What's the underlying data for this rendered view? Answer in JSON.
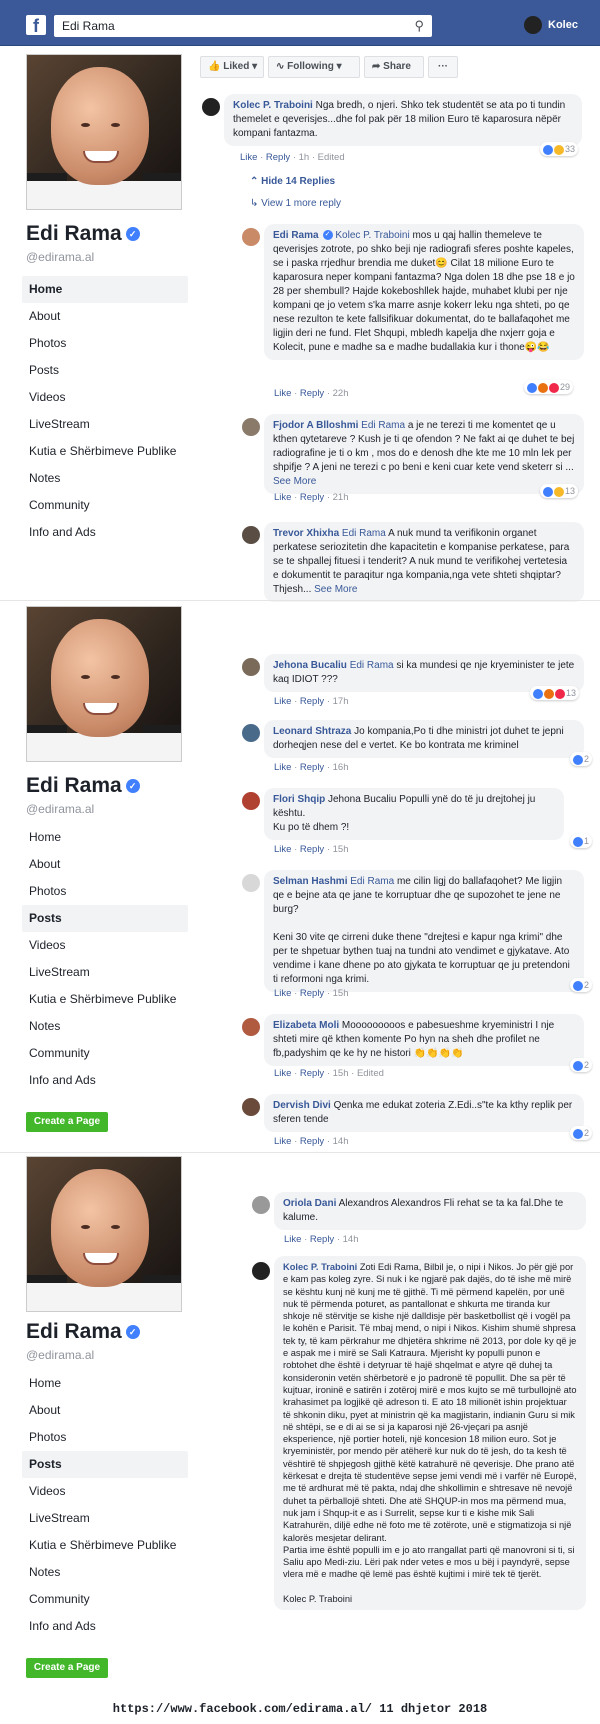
{
  "topbar": {
    "search_value": "Edi Rama",
    "user_name": "Kolec"
  },
  "profile": {
    "name": "Edi Rama",
    "handle": "@edirama.al",
    "nav": [
      "Home",
      "About",
      "Photos",
      "Posts",
      "Videos",
      "LiveStream",
      "Kutia e Shërbimeve Publike",
      "Notes",
      "Community",
      "Info and Ads"
    ],
    "create_page": "Create a Page"
  },
  "actions": {
    "liked": "Liked",
    "following": "Following",
    "share": "Share",
    "more": "···"
  },
  "c1": {
    "author": "Kolec P. Traboini",
    "text": "Nga bredh, o njeri. Shko tek studentët se ata po ti tundin themelet e qeverisjes...dhe fol pak për 18 milion Euro të kaparosura nëpër kompani fantazma.",
    "like": "Like",
    "reply": "Reply",
    "time": "1h",
    "edited": "Edited",
    "reacts": "33"
  },
  "hide_replies": "Hide 14 Replies",
  "more_reply": "View 1 more reply",
  "r1": {
    "author": "Edi Rama",
    "mention": "Kolec P. Traboini",
    "text": "mos u qaj hallin themeleve te qeverisjes zotrote, po shko beji nje radiografi sferes poshte kapeles, se i paska rrjedhur brendia me duket😊 Cilat 18 milione Euro te kaparosura neper kompani fantazma? Nga dolen 18 dhe pse 18 e jo 28 per shembull? Hajde kokeboshllek hajde, muhabet klubi per nje kompani qe jo vetem s'ka marre asnje kokerr leku nga shteti, po qe nese rezulton te kete fallsifikuar dokumentat, do te ballafaqohet me ligjin deri ne fund. Flet Shqupi, mbledh kapelja dhe nxjerr goja e Kolecit, pune e madhe sa e madhe budallakia kur i thone😜😂",
    "like": "Like",
    "reply": "Reply",
    "time": "22h",
    "reacts": "29"
  },
  "r2": {
    "author": "Fjodor A Blloshmi",
    "mention": "Edi Rama",
    "text": "a je ne terezi ti me komentet qe u kthen qytetareve ? Kush je ti qe ofendon ? Ne fakt ai qe duhet te bej radiografine je ti o km , mos do e denosh dhe kte me 10 mln lek per shpifje ? A jeni ne terezi c po beni e keni cuar kete vend sketerr si ...",
    "see_more": "See More",
    "like": "Like",
    "reply": "Reply",
    "time": "21h",
    "reacts": "13"
  },
  "r3": {
    "author": "Trevor Xhixha",
    "mention": "Edi Rama",
    "text": "A nuk mund ta verifikonin organet perkatese seriozitetin dhe kapacitetin e kompanise perkatese, para se te shpallej fituesi i tenderit? A nuk mund te verifikohej vertetesia e dokumentit te paraqitur nga kompania,nga vete shteti shqiptar?Thjesh...",
    "see_more": "See More"
  },
  "r4": {
    "author": "Jehona Bucaliu",
    "mention": "Edi Rama",
    "text": "si ka mundesi qe nje kryeminister te jete kaq IDIOT ???",
    "like": "Like",
    "reply": "Reply",
    "time": "17h",
    "reacts": "13"
  },
  "r5": {
    "author": "Leonard Shtraza",
    "text": "Jo kompania,Po ti dhe ministri jot duhet te jepni dorheqjen nese del e vertet. Ke bo kontrata me kriminel",
    "like": "Like",
    "reply": "Reply",
    "time": "16h",
    "reacts": "2"
  },
  "r6": {
    "author": "Flori Shqip",
    "text": "Jehona Bucaliu Populli ynë do të ju drejtohej ju kështu.",
    "text2": "Ku po të dhem ?!",
    "like": "Like",
    "reply": "Reply",
    "time": "15h",
    "reacts": "1"
  },
  "r7": {
    "author": "Selman Hashmi",
    "mention": "Edi Rama",
    "text": "me cilin ligj do ballafaqohet? Me ligjin qe e bejne ata qe jane te korruptuar dhe qe supozohet te jene ne burg?",
    "text2": "Keni 30 vite qe cirreni duke thene \"drejtesi e kapur nga krimi\" dhe per te shpetuar bythen tuaj na tundni ato vendimet e gjykatave. Ato vendime i kane dhene po ato gjykata te korruptuar qe ju pretendoni ti reformoni nga krimi.",
    "like": "Like",
    "reply": "Reply",
    "time": "15h",
    "reacts": "2"
  },
  "r8": {
    "author": "Elizabeta Moli",
    "text": "Mooooooooos e pabesueshme kryeministri I nje shteti mire që kthen komente Po hyn na sheh dhe profilet ne fb,padyshim qe ke hy ne histori 👏👏👏👏",
    "like": "Like",
    "reply": "Reply",
    "time": "15h",
    "edited": "Edited",
    "reacts": "2"
  },
  "r9": {
    "author": "Dervish Divi",
    "text": "Qenka me edukat zoteria Z.Edi..s\"te ka kthy replik per sferen tende",
    "like": "Like",
    "reply": "Reply",
    "time": "14h",
    "reacts": "2"
  },
  "r10": {
    "author": "Oriola Dani",
    "text": "Alexandros Alexandros Fli rehat se ta ka fal.Dhe te kalume.",
    "like": "Like",
    "reply": "Reply",
    "time": "14h"
  },
  "r11": {
    "author": "Kolec P. Traboini",
    "text": "Zoti Edi Rama, Bilbil je, o nipi i Nikos. Jo për gjë por e kam pas koleg zyre. Si nuk i ke ngjarë pak dajës, do të ishe më mirë se kështu kunj në kunj me të gjithë. Ti më përmend kapelën, por unë nuk të përmenda poturet, as pantallonat e shkurta me tiranda kur shkoje në stërvitje se kishe një dalldisje për basketbollist që i vogël pa le kohën e Parisit. Të mbaj mend, o nipi i Nikos. Kishim shumë shpresa tek ty, të kam përkrahur me dhjetëra shkrime në 2013, por dole ky që je e aspak me i mirë se Sali Katraura. Mjerisht ky populli punon e robtohet dhe është i detyruar të hajë shqelmat e atyre që duhej ta konsideronin vetën shërbetorë e jo padronë të popullit. Dhe sa për të kujtuar, ironinë e satirën i zotëroj mirë e mos kujto se më turbullojnë ato krahasimet pa logjikë që adreson ti. E ato 18 milionët ishin projektuar të shkonin diku, pyet at ministrin që ka magjistarin, indianin Guru si mik në shtëpi, se e di ai se si ja kaparosi një 26-vjeçari pa asnjë eksperience, një portier hoteli, një koncesion 18 milion euro. Sot je kryeministër, por mendo për atëherë kur nuk do të jesh, do ta kesh të vështirë të shpjegosh gjithë këtë katrahurë në qeverisje. Dhe prano atë kërkesat e drejta të studentëve sepse jemi vendi më i varfër në Europë, me të ardhurat më të pakta, ndaj dhe shkollimin e shtresave në nevojë duhet ta përballojë shteti. Dhe atë SHQUP-in mos ma përmend mua, nuk jam i Shqup-it e as i Surrelit, sepse kur ti e kishe mik Sali Katrahurën, diljë edhe në foto me të zotërote, unë e stigmatizoja si një kalorës mesjetar delirant.",
    "text2": "Partia ime është populli im e jo ato rrangallat parti që manovroni si ti, si Saliu apo Medi-ziu. Lëri pak nder vetes e mos u bëj i payndyrë, sepse vlera më e madhe që lemë pas është kujtimi i mirë tek të tjerët.",
    "sign": "Kolec P. Traboini"
  },
  "footer": "https://www.facebook.com/edirama.al/ 11 dhjetor 2018",
  "colors": {
    "fb_blue": "#3b5998",
    "link": "#385898",
    "create": "#42b72a"
  }
}
